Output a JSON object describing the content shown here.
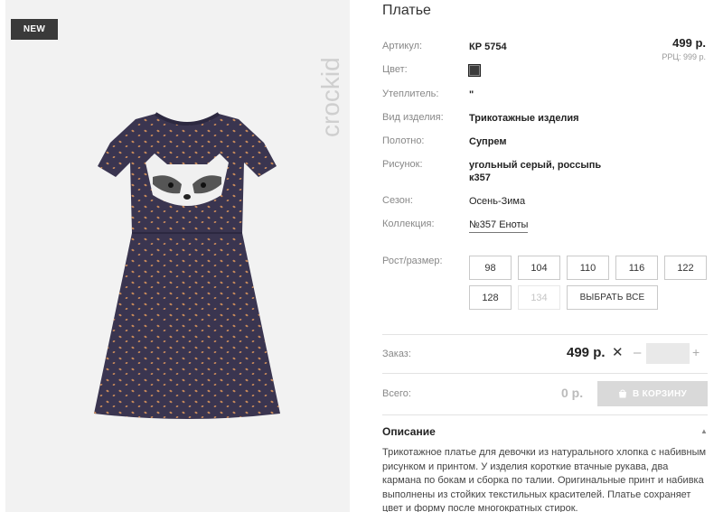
{
  "product": {
    "badge": "NEW",
    "brand": "crockid",
    "title": "Платье",
    "price": "499 р.",
    "rrp": "РРЦ: 999 р."
  },
  "attributes": [
    {
      "label": "Артикул:",
      "value": "КР 5754"
    },
    {
      "label": "Цвет:",
      "value": ""
    },
    {
      "label": "Утеплитель:",
      "value": "\""
    },
    {
      "label": "Вид изделия:",
      "value": "Трикотажные изделия"
    },
    {
      "label": "Полотно:",
      "value": "Супрем"
    },
    {
      "label": "Рисунок:",
      "value": "угольный серый, россыпь к357"
    },
    {
      "label": "Сезон:",
      "value": "Осень-Зима"
    },
    {
      "label": "Коллекция:",
      "value": "№357 Еноты"
    }
  ],
  "swatch_color": "#3b3b3b",
  "sizes": {
    "label": "Рост/размер:",
    "items": [
      {
        "label": "98",
        "available": true
      },
      {
        "label": "104",
        "available": true
      },
      {
        "label": "110",
        "available": true
      },
      {
        "label": "116",
        "available": true
      },
      {
        "label": "122",
        "available": true
      },
      {
        "label": "128",
        "available": true
      },
      {
        "label": "134",
        "available": false
      }
    ],
    "select_all": "ВЫБРАТЬ ВСЕ"
  },
  "order": {
    "label": "Заказ:",
    "price": "499 р.",
    "remove": "✕",
    "minus": "–",
    "plus": "+",
    "quantity": ""
  },
  "total": {
    "label": "Всего:",
    "value": "0 р.",
    "cart_button": "В КОРЗИНУ"
  },
  "description": {
    "title": "Описание",
    "text": "Трикотажное платье для девочки из натурального хлопка с набивным рисунком и принтом. У изделия короткие втачные рукава, два кармана по бокам и сборка по талии. Оригинальные принт и набивка выполнены из стойких текстильных красителей. Платье сохраняет цвет и форму после многократных стирок."
  },
  "colors": {
    "badge_bg": "#3a3a3a",
    "dress": "#3a3550",
    "dots": "#c98a5a",
    "cart_disabled": "#d9d9d9"
  }
}
